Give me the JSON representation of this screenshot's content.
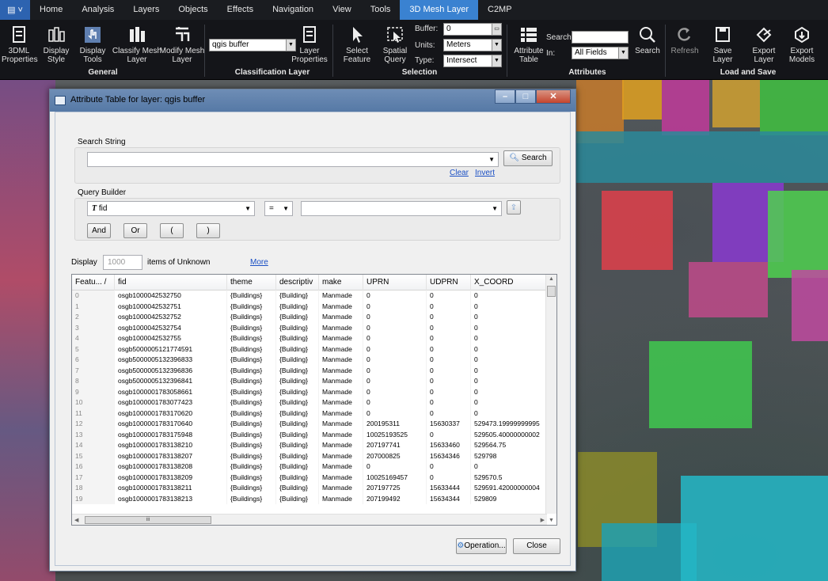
{
  "app": {
    "menu_tabs": [
      "Home",
      "Analysis",
      "Layers",
      "Objects",
      "Effects",
      "Navigation",
      "View",
      "Tools",
      "3D Mesh Layer",
      "C2MP"
    ],
    "active_tab": "3D Mesh Layer"
  },
  "ribbon": {
    "btn_3dml": "3DML Properties",
    "btn_display_style": "Display Style",
    "btn_display_tools": "Display Tools",
    "btn_classify": "Classify Mesh Layer",
    "btn_modify": "Modify Mesh Layer",
    "group_general": "General",
    "layer_select": "qgis buffer",
    "btn_layer_props": "Layer Properties",
    "group_classification": "Classification Layer",
    "btn_select_feature": "Select Feature",
    "btn_spatial_query": "Spatial Query",
    "buffer_label": "Buffer:",
    "buffer_value": "0",
    "units_label": "Units:",
    "units_value": "Meters",
    "type_label": "Type:",
    "type_value": "Intersect",
    "group_selection": "Selection",
    "btn_attr_table": "Attribute Table",
    "search_label": "Search:",
    "in_label": "In:",
    "in_value": "All Fields",
    "btn_search": "Search",
    "group_attributes": "Attributes",
    "btn_refresh": "Refresh",
    "btn_save": "Save Layer",
    "btn_export_layer": "Export Layer",
    "btn_export_models": "Export Models",
    "group_load_save": "Load and Save"
  },
  "dialog": {
    "title": "Attribute Table for layer: qgis buffer",
    "search_string_label": "Search String",
    "search_button": "Search",
    "clear_link": "Clear",
    "invert_link": "Invert",
    "query_builder_label": "Query Builder",
    "field_value": "fid",
    "operator_value": "=",
    "btn_and": "And",
    "btn_or": "Or",
    "btn_open_paren": "(",
    "btn_close_paren": ")",
    "display_label": "Display",
    "display_count": "1000",
    "items_of": "items of Unknown",
    "more_link": "More",
    "operation_button": "Operation...",
    "close_button": "Close"
  },
  "table": {
    "columns": [
      "Featu... /",
      "fid",
      "theme",
      "descriptiv",
      "make",
      "UPRN",
      "UDPRN",
      "X_COORD"
    ],
    "rows": [
      [
        "0",
        "osgb1000042532750",
        "{Buildings}",
        "{Building}",
        "Manmade",
        "0",
        "0",
        "0"
      ],
      [
        "1",
        "osgb1000042532751",
        "{Buildings}",
        "{Building}",
        "Manmade",
        "0",
        "0",
        "0"
      ],
      [
        "2",
        "osgb1000042532752",
        "{Buildings}",
        "{Building}",
        "Manmade",
        "0",
        "0",
        "0"
      ],
      [
        "3",
        "osgb1000042532754",
        "{Buildings}",
        "{Building}",
        "Manmade",
        "0",
        "0",
        "0"
      ],
      [
        "4",
        "osgb1000042532755",
        "{Buildings}",
        "{Building}",
        "Manmade",
        "0",
        "0",
        "0"
      ],
      [
        "5",
        "osgb5000005121774591",
        "{Buildings}",
        "{Building}",
        "Manmade",
        "0",
        "0",
        "0"
      ],
      [
        "6",
        "osgb5000005132396833",
        "{Buildings}",
        "{Building}",
        "Manmade",
        "0",
        "0",
        "0"
      ],
      [
        "7",
        "osgb5000005132396836",
        "{Buildings}",
        "{Building}",
        "Manmade",
        "0",
        "0",
        "0"
      ],
      [
        "8",
        "osgb5000005132396841",
        "{Buildings}",
        "{Building}",
        "Manmade",
        "0",
        "0",
        "0"
      ],
      [
        "9",
        "osgb1000001783058661",
        "{Buildings}",
        "{Building}",
        "Manmade",
        "0",
        "0",
        "0"
      ],
      [
        "10",
        "osgb1000001783077423",
        "{Buildings}",
        "{Building}",
        "Manmade",
        "0",
        "0",
        "0"
      ],
      [
        "11",
        "osgb1000001783170620",
        "{Buildings}",
        "{Building}",
        "Manmade",
        "0",
        "0",
        "0"
      ],
      [
        "12",
        "osgb1000001783170640",
        "{Buildings}",
        "{Building}",
        "Manmade",
        "200195311",
        "15630337",
        "529473.19999999995"
      ],
      [
        "13",
        "osgb1000001783175948",
        "{Buildings}",
        "{Building}",
        "Manmade",
        "10025193525",
        "0",
        "529505.40000000002"
      ],
      [
        "14",
        "osgb1000001783138210",
        "{Buildings}",
        "{Building}",
        "Manmade",
        "207197741",
        "15633460",
        "529564.75"
      ],
      [
        "15",
        "osgb1000001783138207",
        "{Buildings}",
        "{Building}",
        "Manmade",
        "207000825",
        "15634346",
        "529798"
      ],
      [
        "16",
        "osgb1000001783138208",
        "{Buildings}",
        "{Building}",
        "Manmade",
        "0",
        "0",
        "0"
      ],
      [
        "17",
        "osgb1000001783138209",
        "{Buildings}",
        "{Building}",
        "Manmade",
        "10025169457",
        "0",
        "529570.5"
      ],
      [
        "18",
        "osgb1000001783138211",
        "{Buildings}",
        "{Building}",
        "Manmade",
        "207197725",
        "15633444",
        "529591.42000000004"
      ],
      [
        "19",
        "osgb1000001783138213",
        "{Buildings}",
        "{Building}",
        "Manmade",
        "207199492",
        "15634344",
        "529809"
      ]
    ]
  },
  "icons": [
    "app-menu-icon",
    "document-icon",
    "display-style-icon",
    "cursor-hand-icon",
    "classify-icon",
    "modify-icon",
    "layer-properties-icon",
    "arrow-cursor-icon",
    "spatial-query-icon",
    "attribute-table-icon",
    "magnifier-icon",
    "refresh-icon",
    "save-icon",
    "export-layer-icon",
    "export-models-icon",
    "field-type-icon",
    "query-add-icon",
    "operation-gear-icon"
  ]
}
